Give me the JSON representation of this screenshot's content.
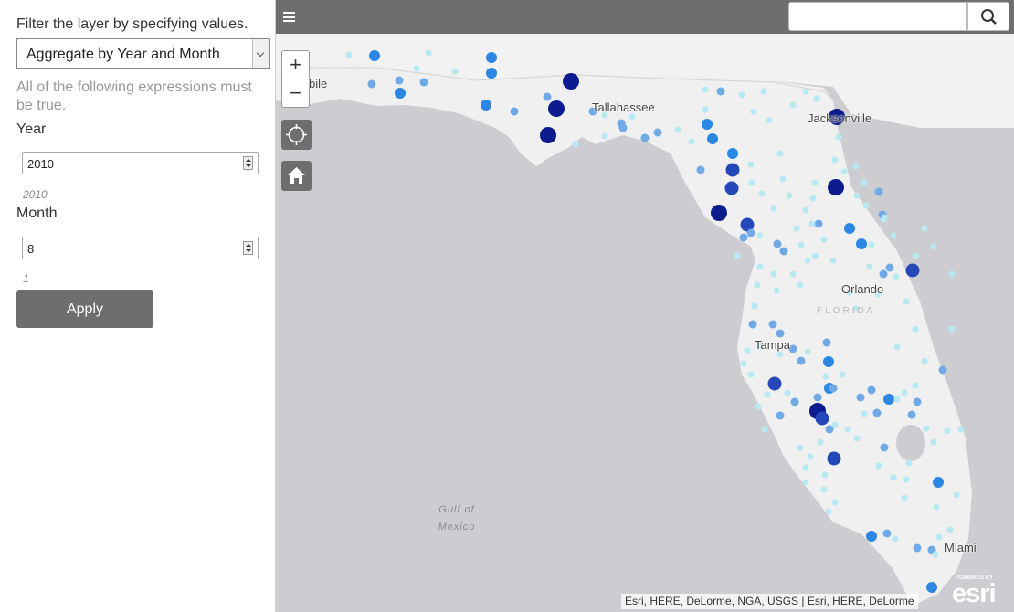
{
  "panel": {
    "title": "Filter the layer by specifying values.",
    "aggregate_select": {
      "value": "Aggregate by Year and Month"
    },
    "hint": "All of the following expressions must be true.",
    "year": {
      "label": "Year",
      "value": "2010",
      "sub": "2010"
    },
    "month": {
      "label": "Month",
      "value": "8",
      "sub": "1"
    },
    "apply_label": "Apply"
  },
  "map": {
    "toolbar": {
      "menu_icon": "hamburger-icon",
      "search_placeholder": "",
      "search_icon": "search-icon"
    },
    "zoom_in": "+",
    "zoom_out": "−",
    "locate_icon": "locate-icon",
    "home_icon": "home-icon",
    "labels": {
      "mobile": "bile",
      "tallahassee": "Tallahassee",
      "jacksonville": "Jacksonville",
      "orlando": "Orlando",
      "tampa": "Tampa",
      "miami": "Miami",
      "gulf_line1": "Gulf of",
      "gulf_line2": "Mexico",
      "state": "FLORIDA"
    },
    "attribution": "Esri, HERE, DeLorme, NGA, USGS | Esri, HERE, DeLorme",
    "logo": {
      "powered": "POWERED BY",
      "name": "esri"
    },
    "colors": {
      "water": "#cdcdd1",
      "land": "#f0f0f0",
      "toolbar": "#6e6e6e"
    }
  }
}
